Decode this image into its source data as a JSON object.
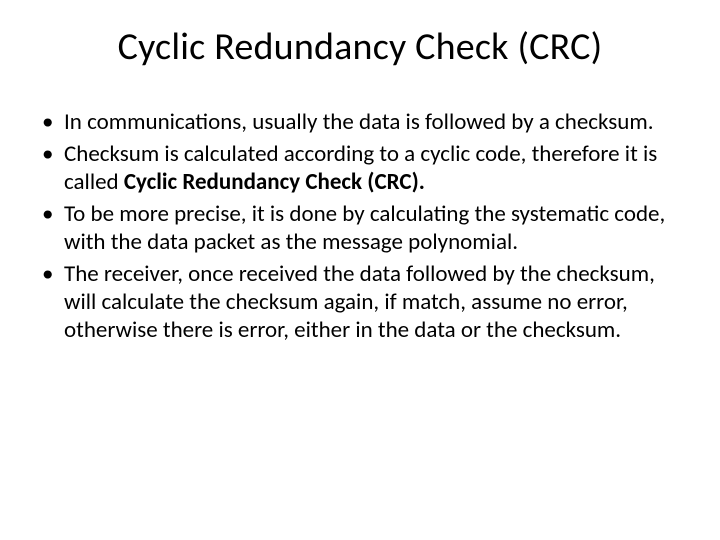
{
  "slide": {
    "title": "Cyclic Redundancy Check (CRC)",
    "bullets": [
      {
        "text_a": "In communications, usually the data is followed by a checksum."
      },
      {
        "text_a": "Checksum is calculated according to a cyclic code, therefore it is called ",
        "bold": "Cyclic Redundancy Check (CRC)."
      },
      {
        "text_a": "To be more precise, it is done by calculating the systematic code, with the data packet as the message polynomial."
      },
      {
        "text_a": "The receiver, once received the data followed by the checksum, will calculate the checksum again, if match, assume no error, otherwise there is error, either in the data or the checksum."
      }
    ]
  }
}
